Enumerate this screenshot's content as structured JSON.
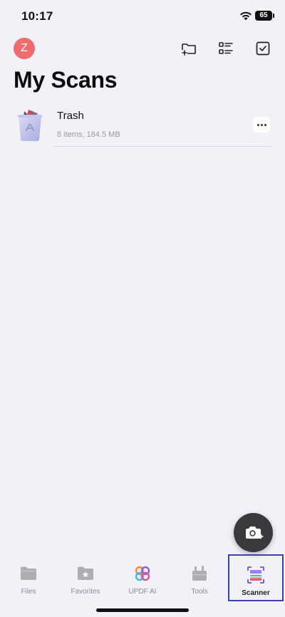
{
  "status_bar": {
    "time": "10:17",
    "battery": "65"
  },
  "header": {
    "avatar_letter": "Z",
    "title": "My Scans"
  },
  "items": [
    {
      "name": "Trash",
      "meta": "8 items, 184.5 MB"
    }
  ],
  "tabs": [
    {
      "label": "Files"
    },
    {
      "label": "Favorites"
    },
    {
      "label": "UPDF AI"
    },
    {
      "label": "Tools"
    },
    {
      "label": "Scanner"
    }
  ],
  "colors": {
    "background": "#f2f1f8",
    "avatar": "#ef6b6e",
    "active_tab_outline": "#3d3fb4",
    "fab": "#3a3a3c"
  },
  "active_tab": "Scanner"
}
